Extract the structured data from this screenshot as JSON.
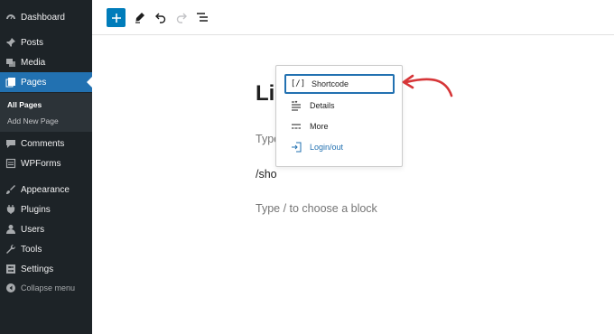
{
  "sidebar": {
    "items": [
      {
        "label": "Dashboard",
        "icon": "dashboard-icon"
      },
      {
        "label": "Posts",
        "icon": "pin-icon"
      },
      {
        "label": "Media",
        "icon": "media-icon"
      },
      {
        "label": "Pages",
        "icon": "pages-icon",
        "active": true
      },
      {
        "label": "Comments",
        "icon": "comments-icon"
      },
      {
        "label": "WPForms",
        "icon": "wpforms-icon"
      },
      {
        "label": "Appearance",
        "icon": "brush-icon"
      },
      {
        "label": "Plugins",
        "icon": "plugin-icon"
      },
      {
        "label": "Users",
        "icon": "users-icon"
      },
      {
        "label": "Tools",
        "icon": "wrench-icon"
      },
      {
        "label": "Settings",
        "icon": "settings-icon"
      }
    ],
    "submenu": [
      {
        "label": "All Pages",
        "current": true
      },
      {
        "label": "Add New Page"
      }
    ],
    "collapse_label": "Collapse menu"
  },
  "toolbar": {
    "add_block": "plus-icon",
    "tools": [
      "pencil-icon",
      "undo-icon",
      "redo-icon",
      "list-view-icon"
    ]
  },
  "editor": {
    "title_partial": "Li",
    "paragraph_placeholder_partial": "Type",
    "slash_command": "/sho",
    "block_placeholder": "Type / to choose a block"
  },
  "autocomplete": {
    "options": [
      {
        "label": "Shortcode",
        "icon": "shortcode-icon",
        "selected": true
      },
      {
        "label": "Details",
        "icon": "details-icon"
      },
      {
        "label": "More",
        "icon": "more-icon"
      },
      {
        "label": "Login/out",
        "icon": "login-icon"
      }
    ]
  },
  "colors": {
    "sidebar_bg": "#1d2327",
    "accent": "#2271b1",
    "annotation": "#d63638"
  }
}
